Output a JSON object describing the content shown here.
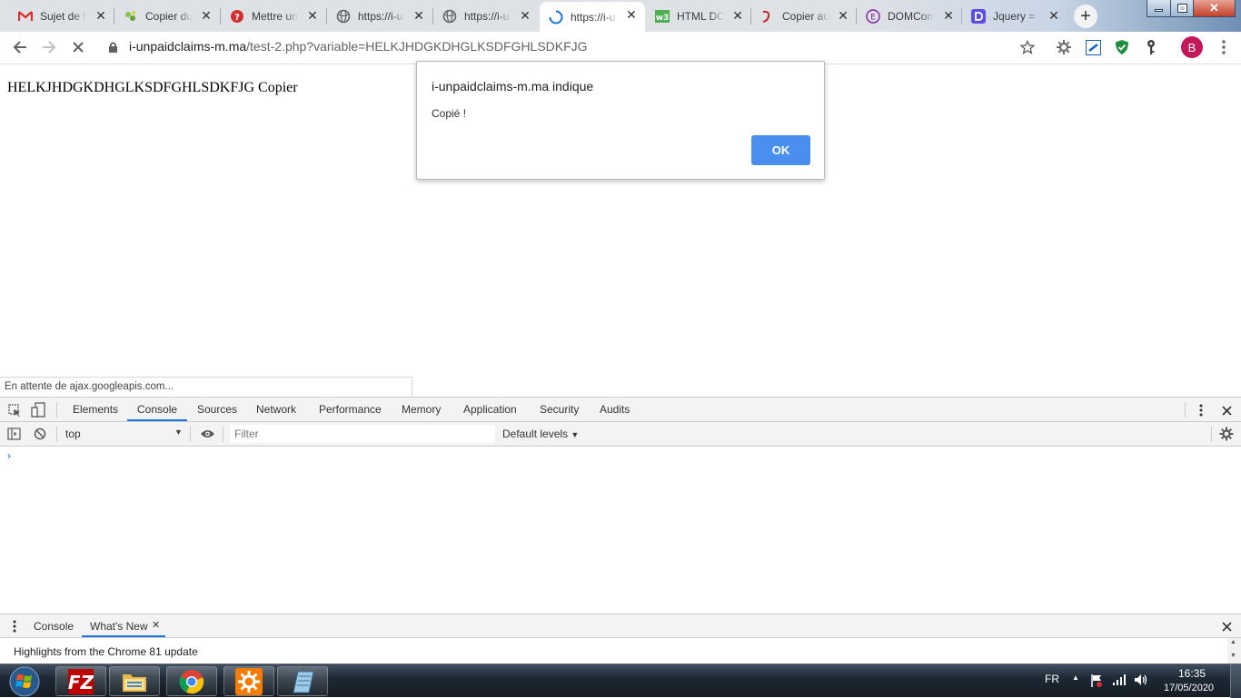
{
  "tabs": [
    {
      "title": "Sujet de l'",
      "favicon": "gmail-icon"
    },
    {
      "title": "Copier du",
      "favicon": "leaf-icon"
    },
    {
      "title": "Mettre un",
      "favicon": "help-icon"
    },
    {
      "title": "https://i-u",
      "favicon": "globe-icon"
    },
    {
      "title": "https://i-u",
      "favicon": "globe-icon"
    },
    {
      "title": "https://i-u",
      "favicon": "loading-icon"
    },
    {
      "title": "HTML DO",
      "favicon": "w3-icon"
    },
    {
      "title": "Copier au",
      "favicon": "pen-icon"
    },
    {
      "title": "DOMCont",
      "favicon": "e-circle-icon"
    },
    {
      "title": "Jquery =",
      "favicon": "d-icon"
    }
  ],
  "address_bar": {
    "host": "i-unpaidclaims-m.ma",
    "path": "/test-2.php?variable=HELKJHDGKDHGLKSDFGHLSDKFJG"
  },
  "profile_initial": "B",
  "page": {
    "text": "HELKJHDGKDHGLKSDFGHLSDKFJG Copier",
    "status": "En attente de ajax.googleapis.com..."
  },
  "dialog": {
    "title": "i-unpaidclaims-m.ma indique",
    "message": "Copié !",
    "ok_label": "OK"
  },
  "devtools": {
    "tabs": [
      "Elements",
      "Console",
      "Sources",
      "Network",
      "Performance",
      "Memory",
      "Application",
      "Security",
      "Audits"
    ],
    "active_tab": "Console",
    "context": "top",
    "filter_placeholder": "Filter",
    "levels": "Default levels",
    "prompt": "›",
    "drawer_tabs": [
      "Console",
      "What's New"
    ],
    "drawer_active": "What's New",
    "drawer_text": "Highlights from the Chrome 81 update"
  },
  "taskbar": {
    "apps": [
      "filezilla-icon",
      "file-explorer-icon",
      "chrome-icon",
      "settings-icon",
      "notepad-icon"
    ],
    "language": "FR",
    "time": "16:35",
    "date": "17/05/2020"
  },
  "colors": {
    "accent": "#1a73e8",
    "dialog_button": "#4a8ff0",
    "profile": "#c2185b"
  }
}
